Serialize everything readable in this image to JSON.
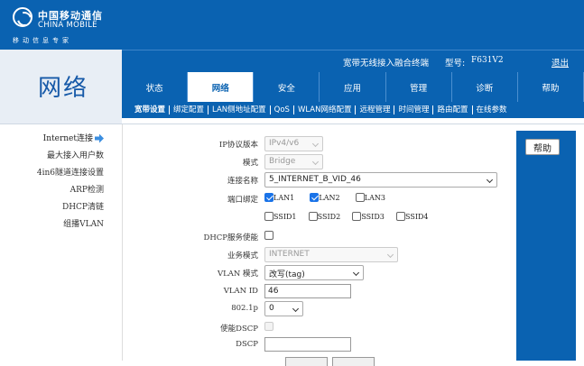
{
  "header": {
    "logo_cn": "中国移动通信",
    "logo_en": "CHINA MOBILE",
    "logo_slogan": "移动信息专家",
    "device_label": "宽带无线接入融合终端",
    "model_label": "型号:",
    "model_value": "F631V2",
    "logout": "退出"
  },
  "section_title": "网络",
  "tabs": [
    {
      "label": "状态",
      "active": false
    },
    {
      "label": "网络",
      "active": true
    },
    {
      "label": "安全",
      "active": false
    },
    {
      "label": "应用",
      "active": false
    },
    {
      "label": "管理",
      "active": false
    },
    {
      "label": "诊断",
      "active": false
    },
    {
      "label": "帮助",
      "active": false
    }
  ],
  "subtabs": [
    {
      "label": "宽带设置",
      "active": true
    },
    {
      "label": "绑定配置",
      "active": false
    },
    {
      "label": "LAN侧地址配置",
      "active": false
    },
    {
      "label": "QoS",
      "active": false
    },
    {
      "label": "WLAN网络配置",
      "active": false
    },
    {
      "label": "远程管理",
      "active": false
    },
    {
      "label": "时间管理",
      "active": false
    },
    {
      "label": "路由配置",
      "active": false
    },
    {
      "label": "在线参数",
      "active": false
    }
  ],
  "sidebar": {
    "items": [
      {
        "label": "Internet连接",
        "active": true
      },
      {
        "label": "最大接入用户数",
        "active": false
      },
      {
        "label": "4in6隧道连接设置",
        "active": false
      },
      {
        "label": "ARP检测",
        "active": false
      },
      {
        "label": "DHCP清链",
        "active": false
      },
      {
        "label": "组播VLAN",
        "active": false
      }
    ]
  },
  "form": {
    "ip_version": {
      "label": "IP协议版本",
      "value": "IPv4/v6"
    },
    "mode": {
      "label": "模式",
      "value": "Bridge"
    },
    "connection_name": {
      "label": "连接名称",
      "value": "5_INTERNET_B_VID_46"
    },
    "port_binding": {
      "label": "端口绑定",
      "ports": [
        {
          "name": "LAN1",
          "checked": true
        },
        {
          "name": "LAN2",
          "checked": true
        },
        {
          "name": "LAN3",
          "checked": false
        }
      ],
      "ssids": [
        {
          "name": "SSID1",
          "checked": false
        },
        {
          "name": "SSID2",
          "checked": false
        },
        {
          "name": "SSID3",
          "checked": false
        },
        {
          "name": "SSID4",
          "checked": false
        }
      ]
    },
    "dhcp_service": {
      "label": "DHCP服务使能",
      "checked": false
    },
    "service_mode": {
      "label": "业务模式",
      "value": "INTERNET"
    },
    "vlan_mode": {
      "label": "VLAN 模式",
      "value": "改写(tag)"
    },
    "vlan_id": {
      "label": "VLAN ID",
      "value": "46"
    },
    "p8021": {
      "label": "802.1p",
      "value": "0"
    },
    "enable_dscp": {
      "label": "使能DSCP",
      "checked": false
    },
    "dscp": {
      "label": "DSCP",
      "value": ""
    }
  },
  "help": {
    "button": "帮助"
  },
  "colors": {
    "brand_blue": "#0a62b1",
    "accent_check": "#1a73e8"
  }
}
